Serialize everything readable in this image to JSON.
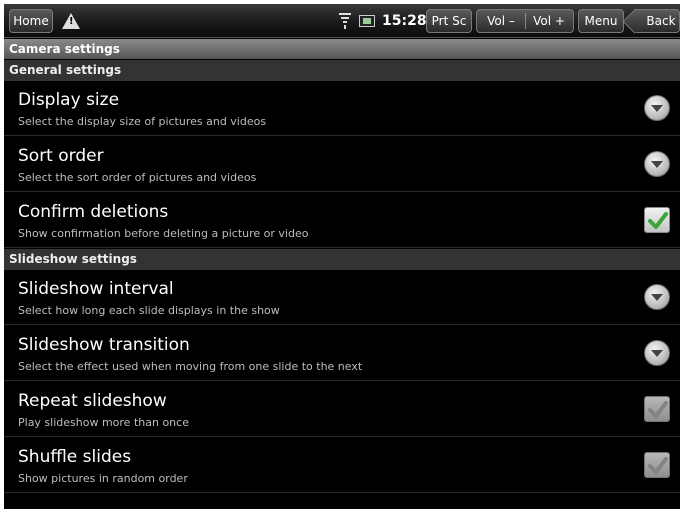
{
  "status_bar": {
    "home_label": "Home",
    "time": "15:28",
    "prtsc_label": "Prt Sc",
    "vol_down_label": "Vol –",
    "vol_up_label": "Vol +",
    "menu_label": "Menu",
    "back_label": "Back"
  },
  "title": "Camera settings",
  "sections": {
    "general": {
      "label": "General settings",
      "items": [
        {
          "title": "Display size",
          "subtitle": "Select the display size of pictures and videos",
          "control": "dropdown"
        },
        {
          "title": "Sort order",
          "subtitle": "Select the sort order of pictures and videos",
          "control": "dropdown"
        },
        {
          "title": "Confirm deletions",
          "subtitle": "Show confirmation before deleting a picture or video",
          "control": "checkbox",
          "checked": true
        }
      ]
    },
    "slideshow": {
      "label": "Slideshow settings",
      "items": [
        {
          "title": "Slideshow interval",
          "subtitle": "Select how long each slide displays in the show",
          "control": "dropdown"
        },
        {
          "title": "Slideshow transition",
          "subtitle": "Select the effect used when moving from one slide to the next",
          "control": "dropdown"
        },
        {
          "title": "Repeat slideshow",
          "subtitle": "Play slideshow more than once",
          "control": "checkbox",
          "checked": false
        },
        {
          "title": "Shuffle slides",
          "subtitle": "Show pictures in random order",
          "control": "checkbox",
          "checked": false
        }
      ]
    }
  },
  "icons": {
    "warning": "warning-icon",
    "wifi": "wifi-icon",
    "battery": "battery-icon",
    "dropdown": "chevron-down-icon",
    "checkbox": "checkbox-icon"
  },
  "colors": {
    "checked_mark": "#3aa63a",
    "unchecked_mark": "#9a9a9a",
    "background": "#000000",
    "section_bg": "#333333"
  }
}
